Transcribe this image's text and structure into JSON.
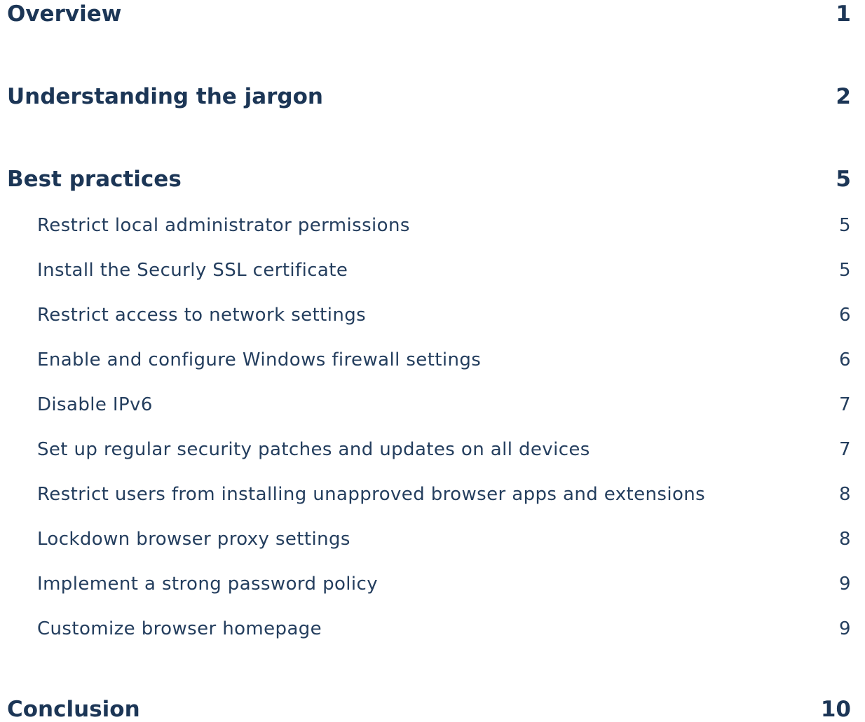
{
  "toc": {
    "sections": [
      {
        "title": "Overview",
        "page": "1"
      },
      {
        "title": "Understanding the jargon",
        "page": "2"
      },
      {
        "title": "Best practices",
        "page": "5"
      },
      {
        "title": "Conclusion",
        "page": "10"
      }
    ],
    "best_practices_entries": [
      {
        "title": "Restrict local administrator permissions",
        "page": "5"
      },
      {
        "title": "Install the Securly SSL certificate",
        "page": "5"
      },
      {
        "title": "Restrict access to network settings",
        "page": "6"
      },
      {
        "title": "Enable and configure Windows firewall settings",
        "page": "6"
      },
      {
        "title": "Disable IPv6",
        "page": "7"
      },
      {
        "title": "Set up regular security patches and updates on all devices",
        "page": "7"
      },
      {
        "title": "Restrict users from installing unapproved browser apps and extensions",
        "page": "8"
      },
      {
        "title": "Lockdown browser proxy settings",
        "page": "8"
      },
      {
        "title": "Implement a strong password policy",
        "page": "9"
      },
      {
        "title": "Customize browser homepage",
        "page": "9"
      }
    ]
  },
  "colors": {
    "text_primary": "#1c3656",
    "background": "#ffffff"
  }
}
